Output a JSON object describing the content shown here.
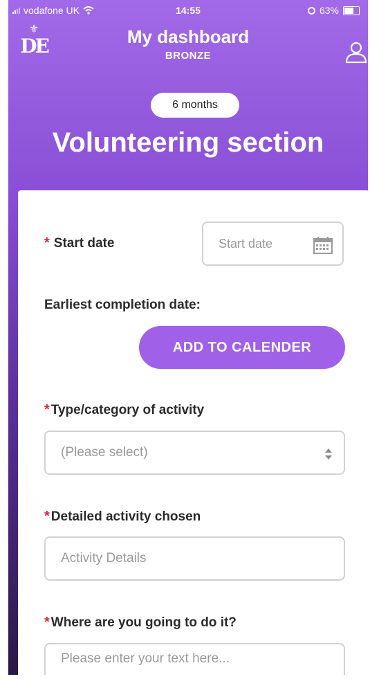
{
  "status": {
    "carrier": "vodafone UK",
    "time": "14:55",
    "battery": "63%"
  },
  "header": {
    "logo_text": "DE",
    "title": "My dashboard",
    "subtitle": "BRONZE"
  },
  "section": {
    "duration_badge": "6 months",
    "title": "Volunteering section"
  },
  "form": {
    "start_date": {
      "required_mark": "*",
      "label": "Start date",
      "placeholder": "Start date"
    },
    "earliest_completion_label": "Earliest completion date:",
    "add_to_calendar_label": "ADD TO CALENDER",
    "activity_type": {
      "required_mark": "*",
      "label": "Type/category of activity",
      "selected": "(Please select)"
    },
    "activity_details": {
      "required_mark": "*",
      "label": "Detailed activity chosen",
      "placeholder": "Activity Details"
    },
    "location": {
      "required_mark": "*",
      "label": "Where are you going to do it?",
      "placeholder": "Please enter your text here..."
    }
  },
  "colors": {
    "header_purple": "#a26ae8",
    "button_purple": "#a060e8",
    "required_red": "#e0263a"
  }
}
